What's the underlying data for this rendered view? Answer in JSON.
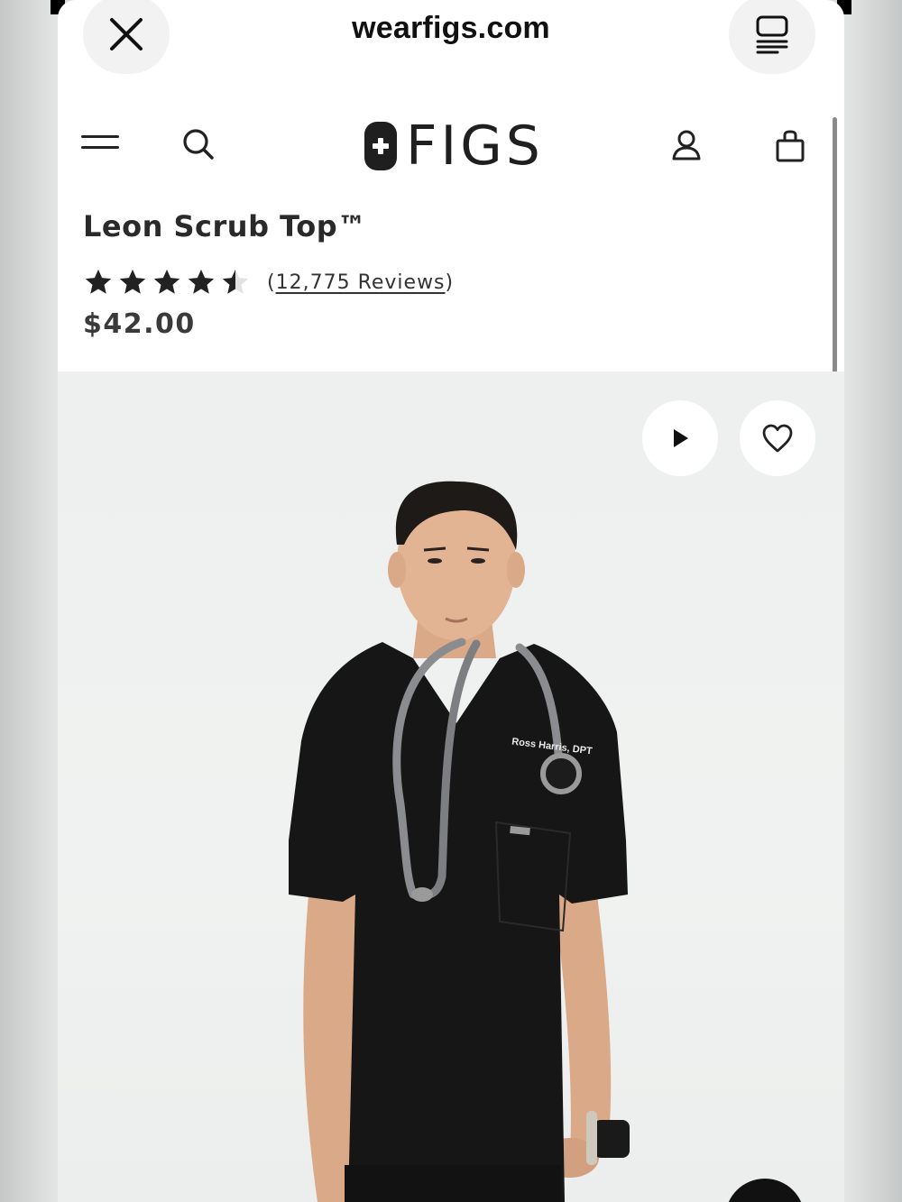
{
  "browser": {
    "url": "wearfigs.com",
    "close_icon": "close-icon",
    "reader_icon": "reader-mode-icon"
  },
  "header": {
    "logo_text": "FIGS",
    "menu_icon": "hamburger-menu-icon",
    "search_icon": "search-icon",
    "account_icon": "account-icon",
    "bag_icon": "shopping-bag-icon"
  },
  "product": {
    "title": "Leon Scrub Top™",
    "rating": 4.5,
    "rating_max": 5,
    "reviews_open": "(",
    "reviews_link": "12,775 Reviews",
    "reviews_close": ")",
    "price": "$42.00",
    "name_badge": "Ross Harris, DPT"
  },
  "media": {
    "play_icon": "play-icon",
    "wishlist_icon": "heart-icon"
  },
  "colors": {
    "text": "#2a2a2a",
    "scrub": "#161616",
    "background": "#eef0ef"
  }
}
